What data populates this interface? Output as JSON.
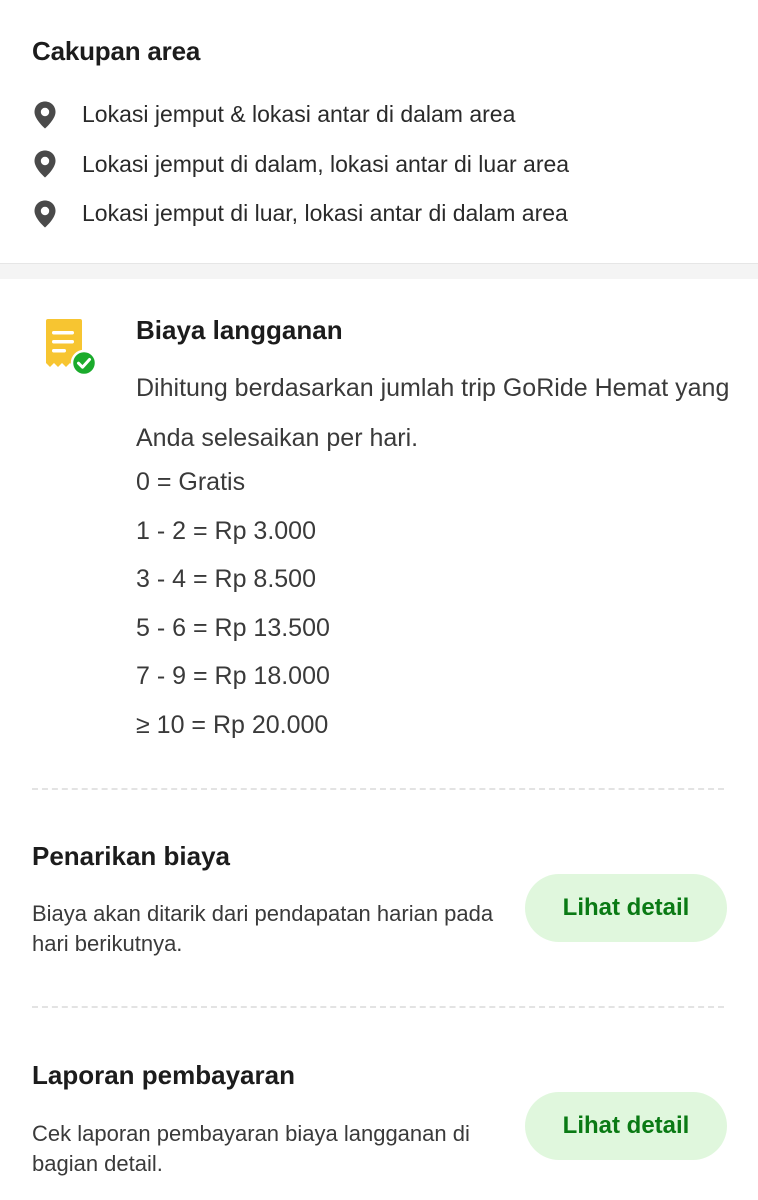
{
  "coverage": {
    "title": "Cakupan area",
    "items": [
      {
        "icon": "location-pin-icon",
        "label": "Lokasi jemput & lokasi antar di dalam area"
      },
      {
        "icon": "location-pin-icon",
        "label": "Lokasi jemput di dalam, lokasi antar di luar area"
      },
      {
        "icon": "location-pin-icon",
        "label": "Lokasi jemput di luar, lokasi antar di dalam area"
      }
    ]
  },
  "subscription_fee": {
    "icon": "receipt-check-icon",
    "title": "Biaya langganan",
    "description": "Dihitung berdasarkan jumlah trip GoRide Hemat yang Anda selesaikan per hari.",
    "tiers": [
      "0 = Gratis",
      "1 - 2 = Rp 3.000",
      "3 - 4 = Rp 8.500",
      "5 - 6 = Rp 13.500",
      "7 - 9 = Rp 18.000",
      "≥ 10 = Rp 20.000"
    ]
  },
  "withdrawal": {
    "title": "Penarikan biaya",
    "description": "Biaya akan ditarik dari pendapatan harian pada hari berikutnya.",
    "button_label": "Lihat detail"
  },
  "payment_report": {
    "title": "Laporan pembayaran",
    "description": "Cek laporan pembayaran biaya langganan di bagian detail.",
    "button_label": "Lihat detail"
  },
  "colors": {
    "icon_gray": "#4a4a4a",
    "receipt_yellow": "#f7c531",
    "check_green": "#1bab2c",
    "button_bg": "#e0f7dd",
    "button_text": "#0a7a14"
  }
}
